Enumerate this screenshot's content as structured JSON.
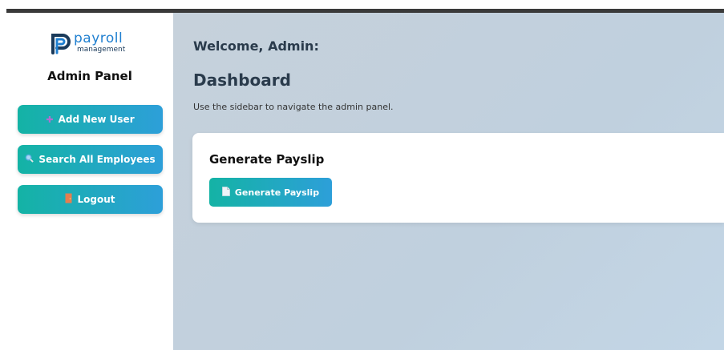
{
  "logo": {
    "word": "payroll",
    "sub": "management"
  },
  "sidebar": {
    "title": "Admin Panel",
    "buttons": [
      {
        "label": "Add New User",
        "icon": "plus-icon",
        "icon_color": "#9b59b6"
      },
      {
        "label": "Search All Employees",
        "icon": "magnifier-icon",
        "icon_color": "#5dade2"
      },
      {
        "label": "Logout",
        "icon": "door-icon",
        "icon_color": "#e67e50"
      }
    ]
  },
  "main": {
    "welcome": "Welcome, Admin:",
    "title": "Dashboard",
    "hint": "Use the sidebar to navigate the admin panel.",
    "card": {
      "title": "Generate Payslip",
      "button_label": "Generate Payslip",
      "button_icon": "document-icon"
    }
  },
  "colors": {
    "accent_start": "#14b3a5",
    "accent_end": "#2d9fd9",
    "heading": "#2a3b4c"
  }
}
